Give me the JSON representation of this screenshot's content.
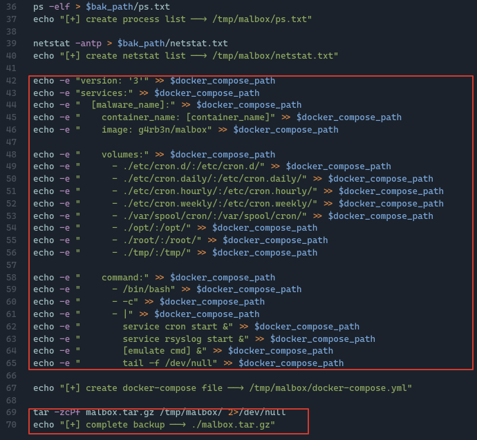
{
  "lines": [
    {
      "n": 36,
      "tokens": [
        {
          "c": "plain",
          "t": "ps "
        },
        {
          "c": "flag",
          "t": "-elf"
        },
        {
          "c": "plain",
          "t": " "
        },
        {
          "c": "op",
          "t": ">"
        },
        {
          "c": "plain",
          "t": " "
        },
        {
          "c": "var",
          "t": "$bak_path"
        },
        {
          "c": "plain",
          "t": "/ps.txt"
        }
      ]
    },
    {
      "n": 37,
      "tokens": [
        {
          "c": "cmd",
          "t": "echo"
        },
        {
          "c": "plain",
          "t": " "
        },
        {
          "c": "str",
          "t": "\"[+] create process list ──→ /tmp/malbox/ps.txt\""
        }
      ]
    },
    {
      "n": 38,
      "tokens": []
    },
    {
      "n": 39,
      "tokens": [
        {
          "c": "plain",
          "t": "netstat "
        },
        {
          "c": "flag",
          "t": "-antp"
        },
        {
          "c": "plain",
          "t": " "
        },
        {
          "c": "op",
          "t": ">"
        },
        {
          "c": "plain",
          "t": " "
        },
        {
          "c": "var",
          "t": "$bak_path"
        },
        {
          "c": "plain",
          "t": "/netstat.txt"
        }
      ]
    },
    {
      "n": 40,
      "tokens": [
        {
          "c": "cmd",
          "t": "echo"
        },
        {
          "c": "plain",
          "t": " "
        },
        {
          "c": "str",
          "t": "\"[+] create netstat list ──→ /tmp/malbox/netstat.txt\""
        }
      ]
    },
    {
      "n": 41,
      "tokens": []
    },
    {
      "n": 42,
      "tokens": [
        {
          "c": "cmd",
          "t": "echo"
        },
        {
          "c": "plain",
          "t": " "
        },
        {
          "c": "flag",
          "t": "-e"
        },
        {
          "c": "plain",
          "t": " "
        },
        {
          "c": "str",
          "t": "\"version: '3'\""
        },
        {
          "c": "plain",
          "t": " "
        },
        {
          "c": "op",
          "t": ">>"
        },
        {
          "c": "plain",
          "t": " "
        },
        {
          "c": "var",
          "t": "$docker_compose_path"
        }
      ]
    },
    {
      "n": 43,
      "tokens": [
        {
          "c": "cmd",
          "t": "echo"
        },
        {
          "c": "plain",
          "t": " "
        },
        {
          "c": "flag",
          "t": "-e"
        },
        {
          "c": "plain",
          "t": " "
        },
        {
          "c": "str",
          "t": "\"services:\""
        },
        {
          "c": "plain",
          "t": " "
        },
        {
          "c": "op",
          "t": ">>"
        },
        {
          "c": "plain",
          "t": " "
        },
        {
          "c": "var",
          "t": "$docker_compose_path"
        }
      ]
    },
    {
      "n": 44,
      "tokens": [
        {
          "c": "cmd",
          "t": "echo"
        },
        {
          "c": "plain",
          "t": " "
        },
        {
          "c": "flag",
          "t": "-e"
        },
        {
          "c": "plain",
          "t": " "
        },
        {
          "c": "str",
          "t": "\"  [malware_name]:\""
        },
        {
          "c": "plain",
          "t": " "
        },
        {
          "c": "op",
          "t": ">>"
        },
        {
          "c": "plain",
          "t": " "
        },
        {
          "c": "var",
          "t": "$docker_compose_path"
        }
      ]
    },
    {
      "n": 45,
      "tokens": [
        {
          "c": "cmd",
          "t": "echo"
        },
        {
          "c": "plain",
          "t": " "
        },
        {
          "c": "flag",
          "t": "-e"
        },
        {
          "c": "plain",
          "t": " "
        },
        {
          "c": "str",
          "t": "\"    container_name: [container_name]\""
        },
        {
          "c": "plain",
          "t": " "
        },
        {
          "c": "op",
          "t": ">>"
        },
        {
          "c": "plain",
          "t": " "
        },
        {
          "c": "var",
          "t": "$docker_compose_path"
        }
      ]
    },
    {
      "n": 46,
      "tokens": [
        {
          "c": "cmd",
          "t": "echo"
        },
        {
          "c": "plain",
          "t": " "
        },
        {
          "c": "flag",
          "t": "-e"
        },
        {
          "c": "plain",
          "t": " "
        },
        {
          "c": "str",
          "t": "\"    image: g4rb3n/malbox\""
        },
        {
          "c": "plain",
          "t": " "
        },
        {
          "c": "op",
          "t": ">>"
        },
        {
          "c": "plain",
          "t": " "
        },
        {
          "c": "var",
          "t": "$docker_compose_path"
        }
      ]
    },
    {
      "n": 47,
      "tokens": []
    },
    {
      "n": 48,
      "tokens": [
        {
          "c": "cmd",
          "t": "echo"
        },
        {
          "c": "plain",
          "t": " "
        },
        {
          "c": "flag",
          "t": "-e"
        },
        {
          "c": "plain",
          "t": " "
        },
        {
          "c": "str",
          "t": "\"    volumes:\""
        },
        {
          "c": "plain",
          "t": " "
        },
        {
          "c": "op",
          "t": ">>"
        },
        {
          "c": "plain",
          "t": " "
        },
        {
          "c": "var",
          "t": "$docker_compose_path"
        }
      ]
    },
    {
      "n": 49,
      "tokens": [
        {
          "c": "cmd",
          "t": "echo"
        },
        {
          "c": "plain",
          "t": " "
        },
        {
          "c": "flag",
          "t": "-e"
        },
        {
          "c": "plain",
          "t": " "
        },
        {
          "c": "str",
          "t": "\"      - ./etc/cron.d/:/etc/cron.d/\""
        },
        {
          "c": "plain",
          "t": " "
        },
        {
          "c": "op",
          "t": ">>"
        },
        {
          "c": "plain",
          "t": " "
        },
        {
          "c": "var",
          "t": "$docker_compose_path"
        }
      ]
    },
    {
      "n": 50,
      "tokens": [
        {
          "c": "cmd",
          "t": "echo"
        },
        {
          "c": "plain",
          "t": " "
        },
        {
          "c": "flag",
          "t": "-e"
        },
        {
          "c": "plain",
          "t": " "
        },
        {
          "c": "str",
          "t": "\"      - ./etc/cron.daily/:/etc/cron.daily/\""
        },
        {
          "c": "plain",
          "t": " "
        },
        {
          "c": "op",
          "t": ">>"
        },
        {
          "c": "plain",
          "t": " "
        },
        {
          "c": "var",
          "t": "$docker_compose_path"
        }
      ]
    },
    {
      "n": 51,
      "tokens": [
        {
          "c": "cmd",
          "t": "echo"
        },
        {
          "c": "plain",
          "t": " "
        },
        {
          "c": "flag",
          "t": "-e"
        },
        {
          "c": "plain",
          "t": " "
        },
        {
          "c": "str",
          "t": "\"      - ./etc/cron.hourly/:/etc/cron.hourly/\""
        },
        {
          "c": "plain",
          "t": " "
        },
        {
          "c": "op",
          "t": ">>"
        },
        {
          "c": "plain",
          "t": " "
        },
        {
          "c": "var",
          "t": "$docker_compose_path"
        }
      ]
    },
    {
      "n": 52,
      "tokens": [
        {
          "c": "cmd",
          "t": "echo"
        },
        {
          "c": "plain",
          "t": " "
        },
        {
          "c": "flag",
          "t": "-e"
        },
        {
          "c": "plain",
          "t": " "
        },
        {
          "c": "str",
          "t": "\"      - ./etc/cron.weekly/:/etc/cron.weekly/\""
        },
        {
          "c": "plain",
          "t": " "
        },
        {
          "c": "op",
          "t": ">>"
        },
        {
          "c": "plain",
          "t": " "
        },
        {
          "c": "var",
          "t": "$docker_compose_path"
        }
      ]
    },
    {
      "n": 53,
      "tokens": [
        {
          "c": "cmd",
          "t": "echo"
        },
        {
          "c": "plain",
          "t": " "
        },
        {
          "c": "flag",
          "t": "-e"
        },
        {
          "c": "plain",
          "t": " "
        },
        {
          "c": "str",
          "t": "\"      - ./var/spool/cron/:/var/spool/cron/\""
        },
        {
          "c": "plain",
          "t": " "
        },
        {
          "c": "op",
          "t": ">>"
        },
        {
          "c": "plain",
          "t": " "
        },
        {
          "c": "var",
          "t": "$docker_compose_path"
        }
      ]
    },
    {
      "n": 54,
      "tokens": [
        {
          "c": "cmd",
          "t": "echo"
        },
        {
          "c": "plain",
          "t": " "
        },
        {
          "c": "flag",
          "t": "-e"
        },
        {
          "c": "plain",
          "t": " "
        },
        {
          "c": "str",
          "t": "\"      - ./opt/:/opt/\""
        },
        {
          "c": "plain",
          "t": " "
        },
        {
          "c": "op",
          "t": ">>"
        },
        {
          "c": "plain",
          "t": " "
        },
        {
          "c": "var",
          "t": "$docker_compose_path"
        }
      ]
    },
    {
      "n": 55,
      "tokens": [
        {
          "c": "cmd",
          "t": "echo"
        },
        {
          "c": "plain",
          "t": " "
        },
        {
          "c": "flag",
          "t": "-e"
        },
        {
          "c": "plain",
          "t": " "
        },
        {
          "c": "str",
          "t": "\"      - ./root/:/root/\""
        },
        {
          "c": "plain",
          "t": " "
        },
        {
          "c": "op",
          "t": ">>"
        },
        {
          "c": "plain",
          "t": " "
        },
        {
          "c": "var",
          "t": "$docker_compose_path"
        }
      ]
    },
    {
      "n": 56,
      "tokens": [
        {
          "c": "cmd",
          "t": "echo"
        },
        {
          "c": "plain",
          "t": " "
        },
        {
          "c": "flag",
          "t": "-e"
        },
        {
          "c": "plain",
          "t": " "
        },
        {
          "c": "str",
          "t": "\"      - ./tmp/:/tmp/\""
        },
        {
          "c": "plain",
          "t": " "
        },
        {
          "c": "op",
          "t": ">>"
        },
        {
          "c": "plain",
          "t": " "
        },
        {
          "c": "var",
          "t": "$docker_compose_path"
        }
      ]
    },
    {
      "n": 57,
      "tokens": []
    },
    {
      "n": 58,
      "tokens": [
        {
          "c": "cmd",
          "t": "echo"
        },
        {
          "c": "plain",
          "t": " "
        },
        {
          "c": "flag",
          "t": "-e"
        },
        {
          "c": "plain",
          "t": " "
        },
        {
          "c": "str",
          "t": "\"    command:\""
        },
        {
          "c": "plain",
          "t": " "
        },
        {
          "c": "op",
          "t": ">>"
        },
        {
          "c": "plain",
          "t": " "
        },
        {
          "c": "var",
          "t": "$docker_compose_path"
        }
      ]
    },
    {
      "n": 59,
      "tokens": [
        {
          "c": "cmd",
          "t": "echo"
        },
        {
          "c": "plain",
          "t": " "
        },
        {
          "c": "flag",
          "t": "-e"
        },
        {
          "c": "plain",
          "t": " "
        },
        {
          "c": "str",
          "t": "\"      - /bin/bash\""
        },
        {
          "c": "plain",
          "t": " "
        },
        {
          "c": "op",
          "t": ">>"
        },
        {
          "c": "plain",
          "t": " "
        },
        {
          "c": "var",
          "t": "$docker_compose_path"
        }
      ]
    },
    {
      "n": 60,
      "tokens": [
        {
          "c": "cmd",
          "t": "echo"
        },
        {
          "c": "plain",
          "t": " "
        },
        {
          "c": "flag",
          "t": "-e"
        },
        {
          "c": "plain",
          "t": " "
        },
        {
          "c": "str",
          "t": "\"      - -c\""
        },
        {
          "c": "plain",
          "t": " "
        },
        {
          "c": "op",
          "t": ">>"
        },
        {
          "c": "plain",
          "t": " "
        },
        {
          "c": "var",
          "t": "$docker_compose_path"
        }
      ]
    },
    {
      "n": 61,
      "tokens": [
        {
          "c": "cmd",
          "t": "echo"
        },
        {
          "c": "plain",
          "t": " "
        },
        {
          "c": "flag",
          "t": "-e"
        },
        {
          "c": "plain",
          "t": " "
        },
        {
          "c": "str",
          "t": "\"      - |\""
        },
        {
          "c": "plain",
          "t": " "
        },
        {
          "c": "op",
          "t": ">>"
        },
        {
          "c": "plain",
          "t": " "
        },
        {
          "c": "var",
          "t": "$docker_compose_path"
        }
      ]
    },
    {
      "n": 62,
      "tokens": [
        {
          "c": "cmd",
          "t": "echo"
        },
        {
          "c": "plain",
          "t": " "
        },
        {
          "c": "flag",
          "t": "-e"
        },
        {
          "c": "plain",
          "t": " "
        },
        {
          "c": "str",
          "t": "\"        service cron start &\""
        },
        {
          "c": "plain",
          "t": " "
        },
        {
          "c": "op",
          "t": ">>"
        },
        {
          "c": "plain",
          "t": " "
        },
        {
          "c": "var",
          "t": "$docker_compose_path"
        }
      ]
    },
    {
      "n": 63,
      "tokens": [
        {
          "c": "cmd",
          "t": "echo"
        },
        {
          "c": "plain",
          "t": " "
        },
        {
          "c": "flag",
          "t": "-e"
        },
        {
          "c": "plain",
          "t": " "
        },
        {
          "c": "str",
          "t": "\"        service rsyslog start &\""
        },
        {
          "c": "plain",
          "t": " "
        },
        {
          "c": "op",
          "t": ">>"
        },
        {
          "c": "plain",
          "t": " "
        },
        {
          "c": "var",
          "t": "$docker_compose_path"
        }
      ]
    },
    {
      "n": 64,
      "tokens": [
        {
          "c": "cmd",
          "t": "echo"
        },
        {
          "c": "plain",
          "t": " "
        },
        {
          "c": "flag",
          "t": "-e"
        },
        {
          "c": "plain",
          "t": " "
        },
        {
          "c": "str",
          "t": "\"        [emulate cmd] &\""
        },
        {
          "c": "plain",
          "t": " "
        },
        {
          "c": "op",
          "t": ">>"
        },
        {
          "c": "plain",
          "t": " "
        },
        {
          "c": "var",
          "t": "$docker_compose_path"
        }
      ]
    },
    {
      "n": 65,
      "tokens": [
        {
          "c": "cmd",
          "t": "echo"
        },
        {
          "c": "plain",
          "t": " "
        },
        {
          "c": "flag",
          "t": "-e"
        },
        {
          "c": "plain",
          "t": " "
        },
        {
          "c": "str",
          "t": "\"        tail -f /dev/null\""
        },
        {
          "c": "plain",
          "t": " "
        },
        {
          "c": "op",
          "t": ">>"
        },
        {
          "c": "plain",
          "t": " "
        },
        {
          "c": "var",
          "t": "$docker_compose_path"
        }
      ]
    },
    {
      "n": 66,
      "tokens": []
    },
    {
      "n": 67,
      "tokens": [
        {
          "c": "cmd",
          "t": "echo"
        },
        {
          "c": "plain",
          "t": " "
        },
        {
          "c": "str",
          "t": "\"[+] create docker-compose file ──→ /tmp/malbox/docker-compose.yml\""
        }
      ]
    },
    {
      "n": 68,
      "tokens": []
    },
    {
      "n": 69,
      "tokens": [
        {
          "c": "plain",
          "t": "tar "
        },
        {
          "c": "flag",
          "t": "-zcPf"
        },
        {
          "c": "plain",
          "t": " malbox.tar.gz /tmp/malbox/ "
        },
        {
          "c": "num",
          "t": "2>"
        },
        {
          "c": "plain",
          "t": "/dev/null"
        }
      ]
    },
    {
      "n": 70,
      "tokens": [
        {
          "c": "cmd",
          "t": "echo"
        },
        {
          "c": "plain",
          "t": " "
        },
        {
          "c": "str",
          "t": "\"[+] complete backup ──→ ./malbox.tar.gz\""
        }
      ]
    }
  ]
}
